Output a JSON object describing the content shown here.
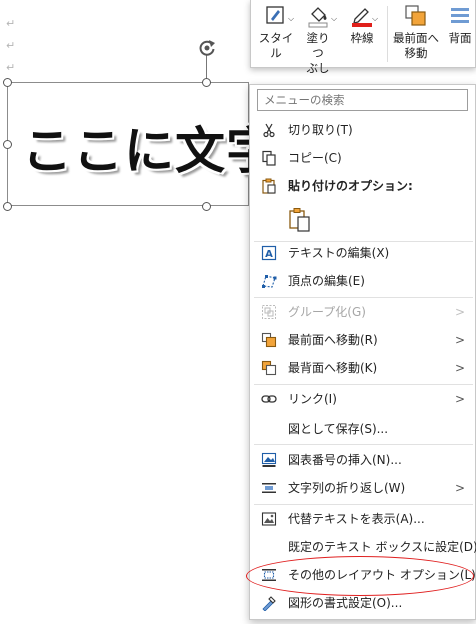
{
  "document": {
    "textbox_text": "ここに文字",
    "paragraph_mark": "↵"
  },
  "toolbar": {
    "style_label": "スタイル",
    "fill_label_1": "塗りつ",
    "fill_label_2": "ぶし",
    "outline_label": "枠線",
    "bring_front_label_1": "最前面へ",
    "bring_front_label_2": "移動",
    "back_label": "背面",
    "accent_red": "#e0201b",
    "accent_orange": "#f2a43a"
  },
  "menu": {
    "search_placeholder": "メニューの検索",
    "items": {
      "cut": "切り取り(T)",
      "copy": "コピー(C)",
      "paste_options": "貼り付けのオプション:",
      "edit_text": "テキストの編集(X)",
      "edit_points": "頂点の編集(E)",
      "group": "グループ化(G)",
      "bring_to_front": "最前面へ移動(R)",
      "send_to_back": "最背面へ移動(K)",
      "link": "リンク(I)",
      "save_as_picture": "図として保存(S)...",
      "insert_caption": "図表番号の挿入(N)...",
      "wrap_text": "文字列の折り返し(W)",
      "alt_text": "代替テキストを表示(A)...",
      "set_default_textbox": "既定のテキスト ボックスに設定(D)",
      "more_layout": "その他のレイアウト オプション(L)...",
      "format_shape": "図形の書式設定(O)..."
    },
    "submenu_arrow": ">"
  },
  "annotation": {
    "highlight_color": "#e02020"
  }
}
